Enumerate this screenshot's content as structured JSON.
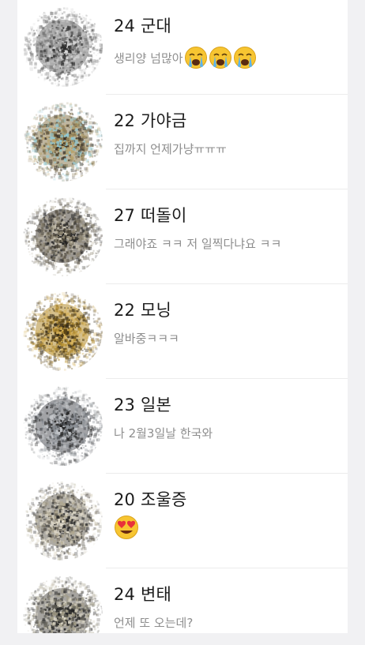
{
  "chat_list": [
    {
      "name": "24 군대",
      "preview": "생리양 넘많아",
      "emoji": "crying-face-icon",
      "emoji_count": 3
    },
    {
      "name": "22 가야금",
      "preview": "집까지 언제가냥ㅠㅠㅠ",
      "emoji": "",
      "emoji_count": 0
    },
    {
      "name": "27 떠돌이",
      "preview": "그래야죠 ㅋㅋ 저 일찍다냐요 ㅋㅋ",
      "emoji": "",
      "emoji_count": 0
    },
    {
      "name": "22 모닝",
      "preview": "알바중ㅋㅋㅋ",
      "emoji": "",
      "emoji_count": 0
    },
    {
      "name": "23 일본",
      "preview": "나 2월3일날 한국와",
      "emoji": "",
      "emoji_count": 0
    },
    {
      "name": "20 조울증",
      "preview": "",
      "emoji": "heart-eyes-face-icon",
      "emoji_count": 1
    },
    {
      "name": "24 변태",
      "preview": "언제 또 오는데?",
      "emoji": "",
      "emoji_count": 0
    }
  ],
  "colors": {
    "background": "#f1f1f3",
    "list_background": "#ffffff",
    "name_text": "#1b1b1b",
    "preview_text": "#8e8e8e",
    "divider": "#ececec",
    "emoji_yellow": "#f7c531"
  },
  "avatar_palettes": [
    [
      "#2e2e2e",
      "#6b6b6b",
      "#a5a5a5",
      "#d8d8d8"
    ],
    [
      "#3a3226",
      "#8a7a52",
      "#b8a36c",
      "#8fc7d2"
    ],
    [
      "#1f1f1f",
      "#4a4438",
      "#8c8470",
      "#c9c2b0"
    ],
    [
      "#5a4416",
      "#b08a2e",
      "#d7b25a",
      "#3a2f1a"
    ],
    [
      "#262626",
      "#55585c",
      "#8a8f95",
      "#c5c8cc"
    ],
    [
      "#2a2a2a",
      "#6a6458",
      "#b0a890",
      "#e2dccb"
    ],
    [
      "#222222",
      "#5c5a52",
      "#a29c86",
      "#d9d4c4"
    ]
  ]
}
